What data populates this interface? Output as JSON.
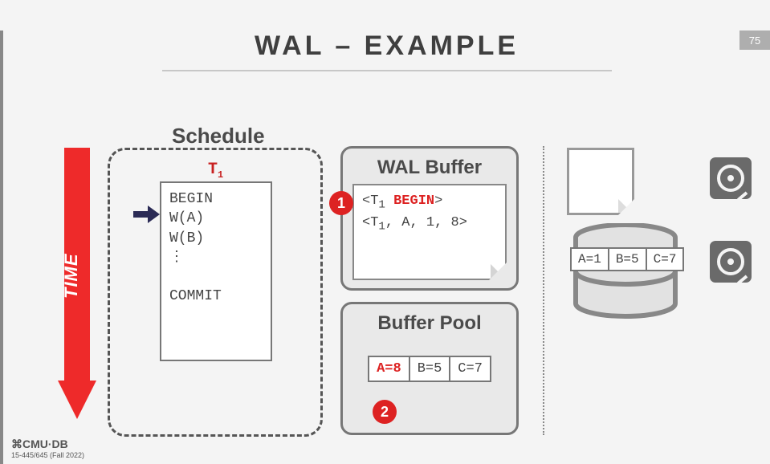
{
  "page_number": "75",
  "title": "WAL – EXAMPLE",
  "time_label": "TIME",
  "schedule": {
    "label": "Schedule",
    "txn_label": "T",
    "txn_sub": "1",
    "ops": "BEGIN\nW(A)\nW(B)\n⋮\n\nCOMMIT"
  },
  "wal": {
    "title": "WAL Buffer",
    "line1_pre": "<T",
    "line1_sub": "1",
    "line1_mid": " ",
    "line1_kw": "BEGIN",
    "line1_post": ">",
    "line2_pre": "<T",
    "line2_sub": "1",
    "line2_rest": ", A, 1, 8>",
    "badge": "1"
  },
  "buffer_pool": {
    "title": "Buffer Pool",
    "cells": {
      "a": "A=8",
      "b": "B=5",
      "c": "C=7"
    },
    "badge": "2"
  },
  "disk": {
    "cells": {
      "a": "A=1",
      "b": "B=5",
      "c": "C=7"
    }
  },
  "footer": {
    "brand": "⌘CMU·DB",
    "course": "15-445/645 (Fall 2022)"
  }
}
